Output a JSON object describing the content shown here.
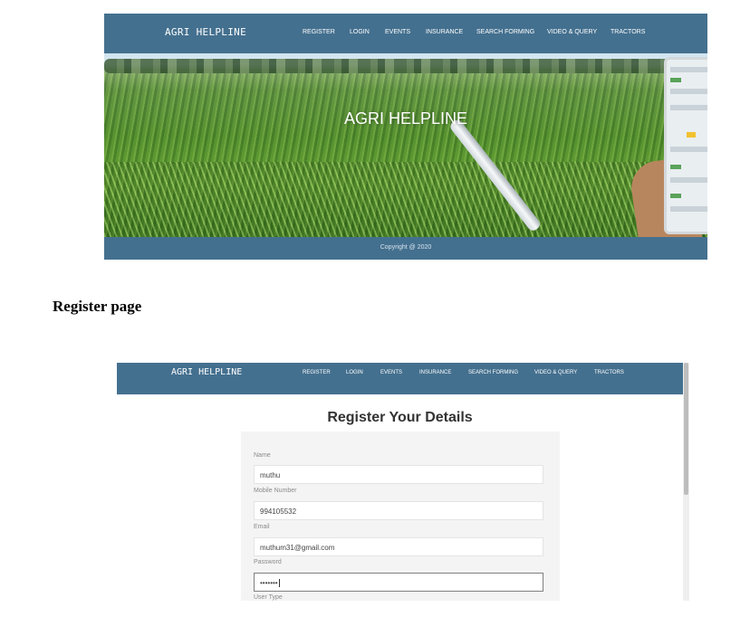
{
  "site": {
    "brand": "AGRI HELPLINE",
    "nav": [
      "REGISTER",
      "LOGIN",
      "EVENTS",
      "INSURANCE",
      "SEARCH FORMING",
      "VIDEO & QUERY",
      "TRACTORS"
    ]
  },
  "home": {
    "hero_title": "AGRI HELPLINE",
    "copyright": "Copyright @ 2020"
  },
  "caption": "Register page",
  "register": {
    "heading": "Register Your Details",
    "fields": [
      {
        "label": "Name",
        "value": "muthu"
      },
      {
        "label": "Mobile Number",
        "value": "994105532"
      },
      {
        "label": "Email",
        "value": "muthum31@gmail.com"
      },
      {
        "label": "Password",
        "value": "•••••••"
      },
      {
        "label": "User Type",
        "value": ""
      }
    ]
  },
  "colors": {
    "nav_bg": "#44708f",
    "form_bg": "#f4f4f4"
  }
}
